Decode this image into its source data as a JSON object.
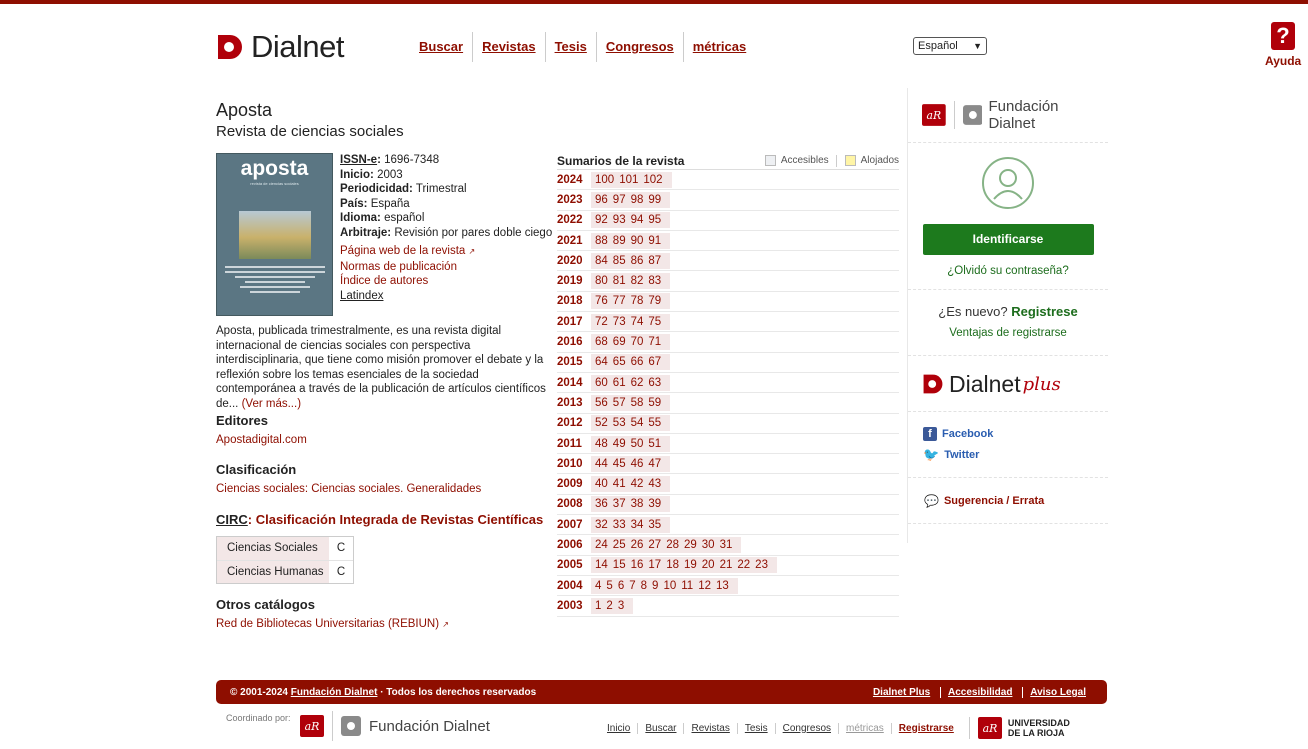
{
  "brand": {
    "name": "Dialnet",
    "plus": "plus",
    "fund_name": "Fundación Dialnet"
  },
  "nav": {
    "items": [
      {
        "label": "Buscar"
      },
      {
        "label": "Revistas"
      },
      {
        "label": "Tesis"
      },
      {
        "label": "Congresos"
      },
      {
        "label": "métricas"
      }
    ],
    "language": "Español",
    "help": "Ayuda"
  },
  "journal": {
    "title": "Aposta",
    "subtitle": "Revista de ciencias sociales",
    "cover_title": "aposta",
    "cover_sub": "revista de ciencias sociales",
    "issn_label": "ISSN-e",
    "issn": "1696-7348",
    "inicio_label": "Inicio:",
    "inicio": "2003",
    "periodicidad_label": "Periodicidad:",
    "periodicidad": "Trimestral",
    "pais_label": "País:",
    "pais": "España",
    "idioma_label": "Idioma:",
    "idioma": "español",
    "arbitraje_label": "Arbitraje:",
    "arbitraje": "Revisión por pares doble ciego",
    "links": [
      "Página web de la revista",
      "Normas de publicación",
      "Índice de autores",
      "Latindex"
    ],
    "description": "Aposta, publicada trimestralmente, es una revista digital internacional de ciencias sociales con perspectiva interdisciplinaria, que tiene como misión promover el debate y la reflexión sobre los temas esenciales de la sociedad contemporánea a través de la publicación de artículos científicos de...",
    "ver_mas": "(Ver más...)",
    "editores_h": "Editores",
    "editores": "Apostadigital.com",
    "clasificacion_h": "Clasificación",
    "clasificacion": "Ciencias sociales: Ciencias sociales. Generalidades",
    "circ_abbr": "CIRC",
    "circ_h": ": Clasificación Integrada de Revistas Científicas",
    "circ_rows": [
      {
        "k": "Ciencias Sociales",
        "v": "C"
      },
      {
        "k": "Ciencias Humanas",
        "v": "C"
      }
    ],
    "otros_h": "Otros catálogos",
    "otros": "Red de Bibliotecas Universitarias (REBIUN)"
  },
  "summaries": {
    "title": "Sumarios de la revista",
    "legend_acc": "Accesibles",
    "legend_alo": "Alojados",
    "years": [
      {
        "y": "2024",
        "n": [
          "100",
          "101",
          "102"
        ]
      },
      {
        "y": "2023",
        "n": [
          "96",
          "97",
          "98",
          "99"
        ]
      },
      {
        "y": "2022",
        "n": [
          "92",
          "93",
          "94",
          "95"
        ]
      },
      {
        "y": "2021",
        "n": [
          "88",
          "89",
          "90",
          "91"
        ]
      },
      {
        "y": "2020",
        "n": [
          "84",
          "85",
          "86",
          "87"
        ]
      },
      {
        "y": "2019",
        "n": [
          "80",
          "81",
          "82",
          "83"
        ]
      },
      {
        "y": "2018",
        "n": [
          "76",
          "77",
          "78",
          "79"
        ]
      },
      {
        "y": "2017",
        "n": [
          "72",
          "73",
          "74",
          "75"
        ]
      },
      {
        "y": "2016",
        "n": [
          "68",
          "69",
          "70",
          "71"
        ]
      },
      {
        "y": "2015",
        "n": [
          "64",
          "65",
          "66",
          "67"
        ]
      },
      {
        "y": "2014",
        "n": [
          "60",
          "61",
          "62",
          "63"
        ]
      },
      {
        "y": "2013",
        "n": [
          "56",
          "57",
          "58",
          "59"
        ]
      },
      {
        "y": "2012",
        "n": [
          "52",
          "53",
          "54",
          "55"
        ]
      },
      {
        "y": "2011",
        "n": [
          "48",
          "49",
          "50",
          "51"
        ]
      },
      {
        "y": "2010",
        "n": [
          "44",
          "45",
          "46",
          "47"
        ]
      },
      {
        "y": "2009",
        "n": [
          "40",
          "41",
          "42",
          "43"
        ]
      },
      {
        "y": "2008",
        "n": [
          "36",
          "37",
          "38",
          "39"
        ]
      },
      {
        "y": "2007",
        "n": [
          "32",
          "33",
          "34",
          "35"
        ]
      },
      {
        "y": "2006",
        "n": [
          "24",
          "25",
          "26",
          "27",
          "28",
          "29",
          "30",
          "31"
        ]
      },
      {
        "y": "2005",
        "n": [
          "14",
          "15",
          "16",
          "17",
          "18",
          "19",
          "20",
          "21",
          "22",
          "23"
        ]
      },
      {
        "y": "2004",
        "n": [
          "4",
          "5",
          "6",
          "7",
          "8",
          "9",
          "10",
          "11",
          "12",
          "13"
        ]
      },
      {
        "y": "2003",
        "n": [
          "1",
          "2",
          "3"
        ]
      }
    ]
  },
  "sidebar": {
    "login_button": "Identificarse",
    "forgot": "¿Olvidó su contraseña?",
    "new_q": "¿Es nuevo?",
    "register": "Registrese",
    "ventajas": "Ventajas de registrarse",
    "facebook": "Facebook",
    "twitter": "Twitter",
    "sugerencia": "Sugerencia / Errata"
  },
  "footer": {
    "copyright_pre": "© 2001-2024",
    "copyright_link": "Fundación Dialnet",
    "copyright_post": "· Todos los derechos reservados",
    "right_links": [
      "Dialnet Plus",
      "Accesibilidad",
      "Aviso Legal"
    ],
    "coord": "Coordinado por:",
    "nav": [
      "Inicio",
      "Buscar",
      "Revistas",
      "Tesis",
      "Congresos",
      "métricas",
      "Registrarse"
    ],
    "ur_line1": "UNIVERSIDAD",
    "ur_line2": "DE LA RIOJA"
  },
  "colors": {
    "brand": "#8e0e00",
    "green": "#1d7a1d"
  }
}
